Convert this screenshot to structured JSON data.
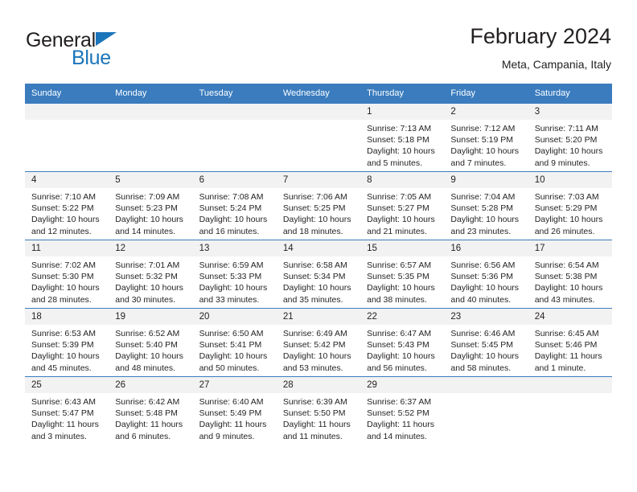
{
  "brand": {
    "name_part1": "General",
    "name_part2": "Blue",
    "accent_color": "#1b75bb"
  },
  "header": {
    "title": "February 2024",
    "subtitle": "Meta, Campania, Italy"
  },
  "calendar": {
    "header_bg": "#3a7cbe",
    "daynum_bg": "#f2f2f2",
    "weekdays": [
      "Sunday",
      "Monday",
      "Tuesday",
      "Wednesday",
      "Thursday",
      "Friday",
      "Saturday"
    ],
    "weeks": [
      [
        {
          "day": "",
          "empty": true
        },
        {
          "day": "",
          "empty": true
        },
        {
          "day": "",
          "empty": true
        },
        {
          "day": "",
          "empty": true
        },
        {
          "day": "1",
          "sunrise": "Sunrise: 7:13 AM",
          "sunset": "Sunset: 5:18 PM",
          "daylight": "Daylight: 10 hours and 5 minutes."
        },
        {
          "day": "2",
          "sunrise": "Sunrise: 7:12 AM",
          "sunset": "Sunset: 5:19 PM",
          "daylight": "Daylight: 10 hours and 7 minutes."
        },
        {
          "day": "3",
          "sunrise": "Sunrise: 7:11 AM",
          "sunset": "Sunset: 5:20 PM",
          "daylight": "Daylight: 10 hours and 9 minutes."
        }
      ],
      [
        {
          "day": "4",
          "sunrise": "Sunrise: 7:10 AM",
          "sunset": "Sunset: 5:22 PM",
          "daylight": "Daylight: 10 hours and 12 minutes."
        },
        {
          "day": "5",
          "sunrise": "Sunrise: 7:09 AM",
          "sunset": "Sunset: 5:23 PM",
          "daylight": "Daylight: 10 hours and 14 minutes."
        },
        {
          "day": "6",
          "sunrise": "Sunrise: 7:08 AM",
          "sunset": "Sunset: 5:24 PM",
          "daylight": "Daylight: 10 hours and 16 minutes."
        },
        {
          "day": "7",
          "sunrise": "Sunrise: 7:06 AM",
          "sunset": "Sunset: 5:25 PM",
          "daylight": "Daylight: 10 hours and 18 minutes."
        },
        {
          "day": "8",
          "sunrise": "Sunrise: 7:05 AM",
          "sunset": "Sunset: 5:27 PM",
          "daylight": "Daylight: 10 hours and 21 minutes."
        },
        {
          "day": "9",
          "sunrise": "Sunrise: 7:04 AM",
          "sunset": "Sunset: 5:28 PM",
          "daylight": "Daylight: 10 hours and 23 minutes."
        },
        {
          "day": "10",
          "sunrise": "Sunrise: 7:03 AM",
          "sunset": "Sunset: 5:29 PM",
          "daylight": "Daylight: 10 hours and 26 minutes."
        }
      ],
      [
        {
          "day": "11",
          "sunrise": "Sunrise: 7:02 AM",
          "sunset": "Sunset: 5:30 PM",
          "daylight": "Daylight: 10 hours and 28 minutes."
        },
        {
          "day": "12",
          "sunrise": "Sunrise: 7:01 AM",
          "sunset": "Sunset: 5:32 PM",
          "daylight": "Daylight: 10 hours and 30 minutes."
        },
        {
          "day": "13",
          "sunrise": "Sunrise: 6:59 AM",
          "sunset": "Sunset: 5:33 PM",
          "daylight": "Daylight: 10 hours and 33 minutes."
        },
        {
          "day": "14",
          "sunrise": "Sunrise: 6:58 AM",
          "sunset": "Sunset: 5:34 PM",
          "daylight": "Daylight: 10 hours and 35 minutes."
        },
        {
          "day": "15",
          "sunrise": "Sunrise: 6:57 AM",
          "sunset": "Sunset: 5:35 PM",
          "daylight": "Daylight: 10 hours and 38 minutes."
        },
        {
          "day": "16",
          "sunrise": "Sunrise: 6:56 AM",
          "sunset": "Sunset: 5:36 PM",
          "daylight": "Daylight: 10 hours and 40 minutes."
        },
        {
          "day": "17",
          "sunrise": "Sunrise: 6:54 AM",
          "sunset": "Sunset: 5:38 PM",
          "daylight": "Daylight: 10 hours and 43 minutes."
        }
      ],
      [
        {
          "day": "18",
          "sunrise": "Sunrise: 6:53 AM",
          "sunset": "Sunset: 5:39 PM",
          "daylight": "Daylight: 10 hours and 45 minutes."
        },
        {
          "day": "19",
          "sunrise": "Sunrise: 6:52 AM",
          "sunset": "Sunset: 5:40 PM",
          "daylight": "Daylight: 10 hours and 48 minutes."
        },
        {
          "day": "20",
          "sunrise": "Sunrise: 6:50 AM",
          "sunset": "Sunset: 5:41 PM",
          "daylight": "Daylight: 10 hours and 50 minutes."
        },
        {
          "day": "21",
          "sunrise": "Sunrise: 6:49 AM",
          "sunset": "Sunset: 5:42 PM",
          "daylight": "Daylight: 10 hours and 53 minutes."
        },
        {
          "day": "22",
          "sunrise": "Sunrise: 6:47 AM",
          "sunset": "Sunset: 5:43 PM",
          "daylight": "Daylight: 10 hours and 56 minutes."
        },
        {
          "day": "23",
          "sunrise": "Sunrise: 6:46 AM",
          "sunset": "Sunset: 5:45 PM",
          "daylight": "Daylight: 10 hours and 58 minutes."
        },
        {
          "day": "24",
          "sunrise": "Sunrise: 6:45 AM",
          "sunset": "Sunset: 5:46 PM",
          "daylight": "Daylight: 11 hours and 1 minute."
        }
      ],
      [
        {
          "day": "25",
          "sunrise": "Sunrise: 6:43 AM",
          "sunset": "Sunset: 5:47 PM",
          "daylight": "Daylight: 11 hours and 3 minutes."
        },
        {
          "day": "26",
          "sunrise": "Sunrise: 6:42 AM",
          "sunset": "Sunset: 5:48 PM",
          "daylight": "Daylight: 11 hours and 6 minutes."
        },
        {
          "day": "27",
          "sunrise": "Sunrise: 6:40 AM",
          "sunset": "Sunset: 5:49 PM",
          "daylight": "Daylight: 11 hours and 9 minutes."
        },
        {
          "day": "28",
          "sunrise": "Sunrise: 6:39 AM",
          "sunset": "Sunset: 5:50 PM",
          "daylight": "Daylight: 11 hours and 11 minutes."
        },
        {
          "day": "29",
          "sunrise": "Sunrise: 6:37 AM",
          "sunset": "Sunset: 5:52 PM",
          "daylight": "Daylight: 11 hours and 14 minutes."
        },
        {
          "day": "",
          "empty": true
        },
        {
          "day": "",
          "empty": true
        }
      ]
    ]
  }
}
